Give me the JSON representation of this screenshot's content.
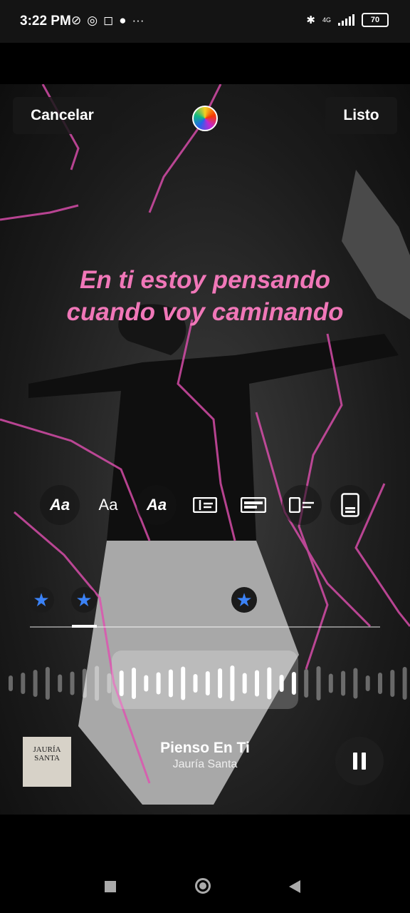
{
  "status_bar": {
    "time": "3:22 PM",
    "network": "4G",
    "battery": "70"
  },
  "editor": {
    "cancel_label": "Cancelar",
    "done_label": "Listo",
    "lyric_lines": [
      "En ti estoy pensando",
      "cuando voy caminando"
    ],
    "lyric_color": "#f077b8",
    "text_styles": [
      "Aa",
      "Aa",
      "Aa"
    ]
  },
  "music": {
    "song_title": "Pienso En Ti",
    "artist": "Jauría Santa",
    "album_cover_text": "JAURÍA SANTA"
  },
  "icons": {
    "status": [
      "muted-vibrate-icon",
      "whatsapp-icon",
      "instagram-icon",
      "discord-icon",
      "more-icon",
      "bluetooth-icon",
      "signal-icon",
      "battery-icon"
    ],
    "layouts": [
      "lyric-layout-left-icon",
      "lyric-layout-card-icon",
      "lyric-layout-line-icon",
      "lyric-layout-page-icon"
    ],
    "marker": "star-icon"
  }
}
